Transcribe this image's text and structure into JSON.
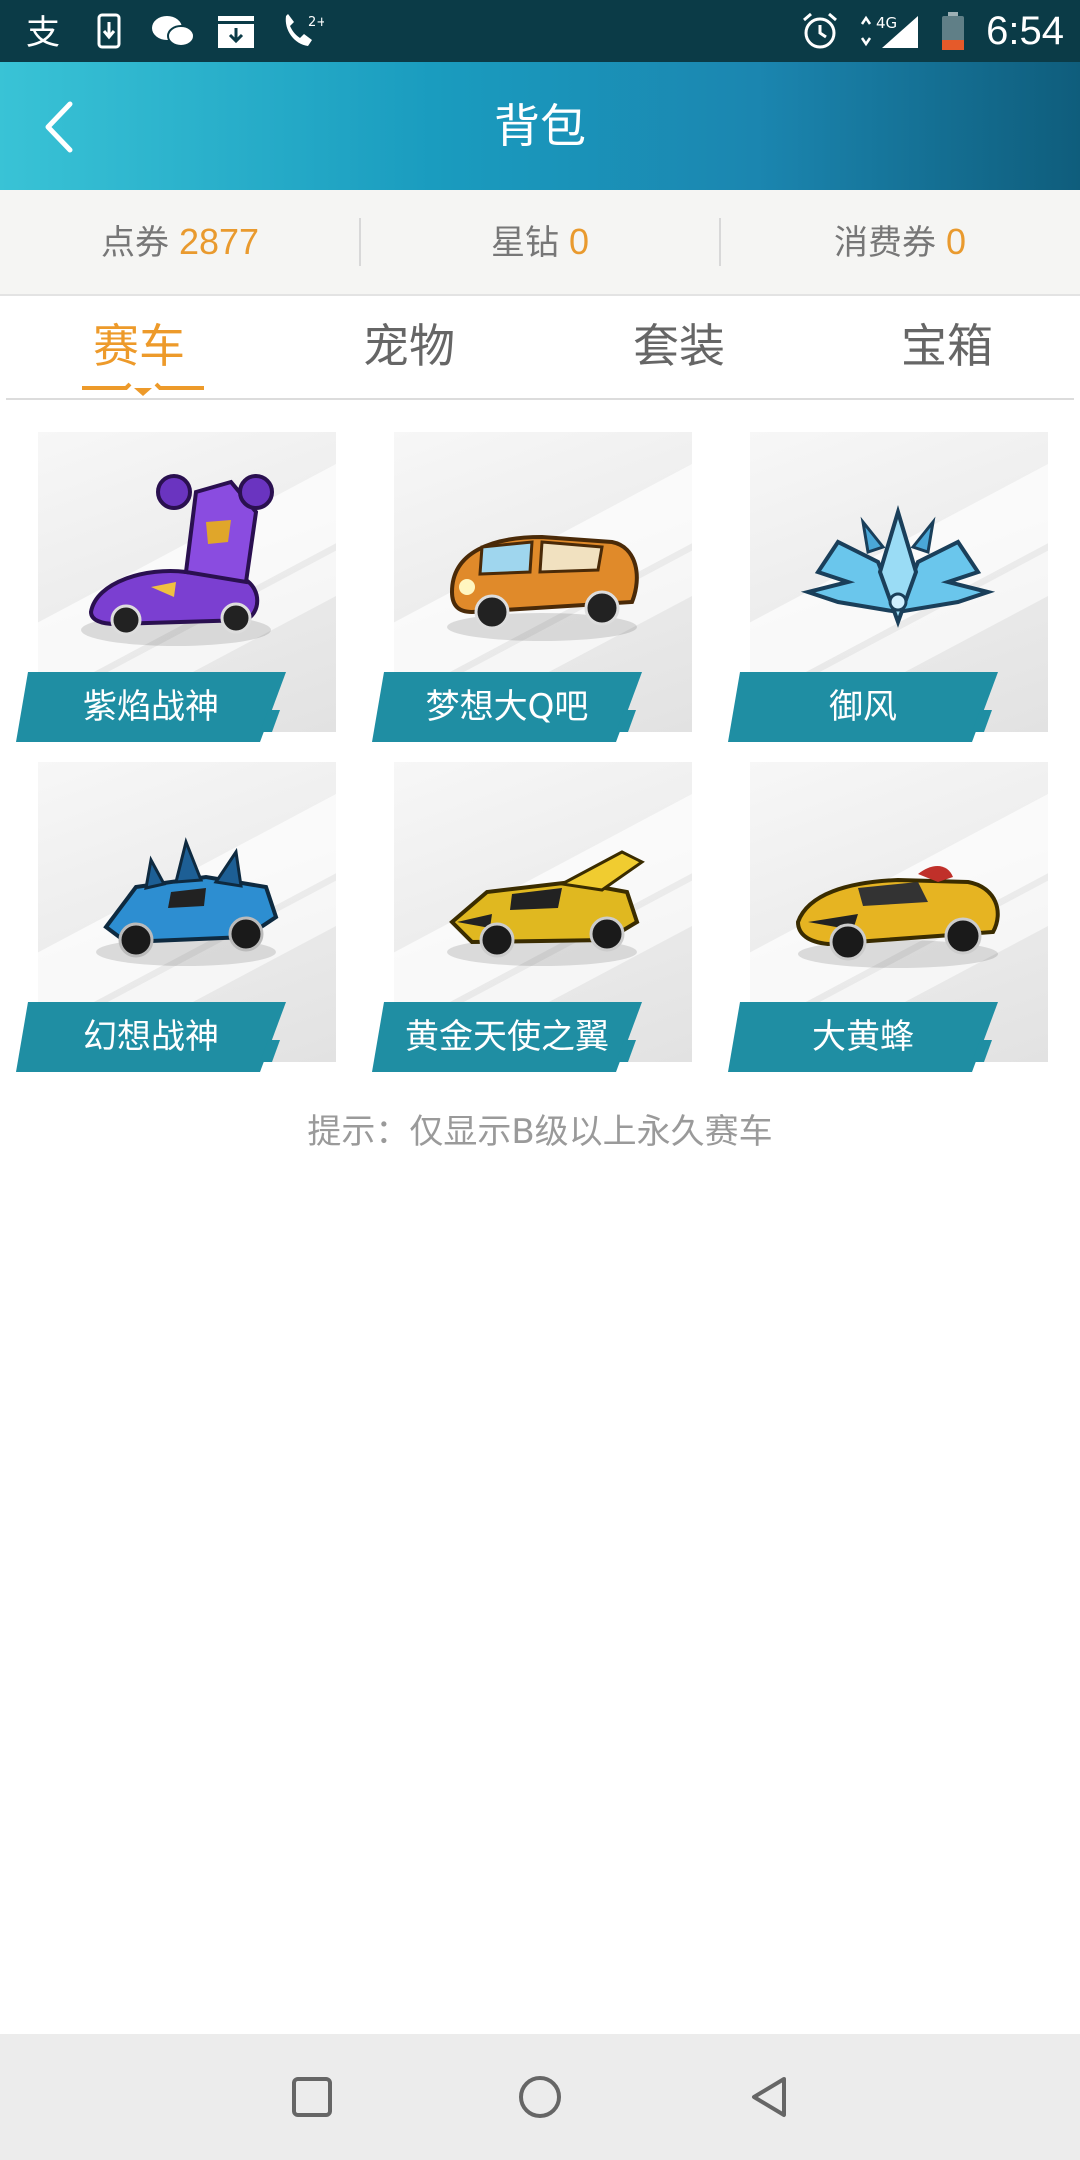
{
  "status_bar": {
    "time": "6:54",
    "network": "4G",
    "left_icons": [
      "alipay-icon",
      "download-icon",
      "wechat-icon",
      "inbox-download-icon",
      "call-icon"
    ]
  },
  "header": {
    "title": "背包"
  },
  "currency": {
    "items": [
      {
        "label": "点券",
        "value": "2877"
      },
      {
        "label": "星钻",
        "value": "0"
      },
      {
        "label": "消费券",
        "value": "0"
      }
    ]
  },
  "tabs": [
    {
      "label": "赛车",
      "active": true
    },
    {
      "label": "宠物",
      "active": false
    },
    {
      "label": "套装",
      "active": false
    },
    {
      "label": "宝箱",
      "active": false
    }
  ],
  "items": [
    {
      "name": "紫焰战神",
      "icon": "purple-mech-car-icon",
      "color": "#7b3fd1"
    },
    {
      "name": "梦想大Q吧",
      "icon": "orange-bus-car-icon",
      "color": "#e08a2a"
    },
    {
      "name": "御风",
      "icon": "blue-crystal-wing-icon",
      "color": "#5ab8e0"
    },
    {
      "name": "幻想战神",
      "icon": "blue-spiked-car-icon",
      "color": "#2d8ed1"
    },
    {
      "name": "黄金天使之翼",
      "icon": "gold-winged-car-icon",
      "color": "#e0b820"
    },
    {
      "name": "大黄蜂",
      "icon": "yellow-sports-car-icon",
      "color": "#e6b422"
    }
  ],
  "hint": "提示：仅显示B级以上永久赛车",
  "colors": {
    "accent": "#ed9a2a",
    "label_bg": "#1f8ea3",
    "header_start": "#39c3d6",
    "header_end": "#0f5d7c"
  }
}
